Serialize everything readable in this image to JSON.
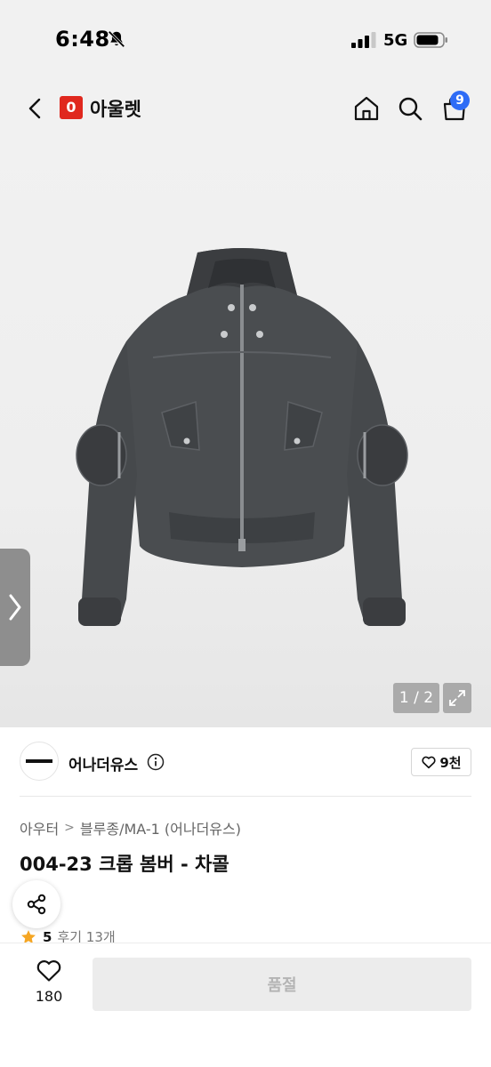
{
  "status_bar": {
    "time": "6:48",
    "network": "5G",
    "icons": [
      "bell-slash-icon",
      "signal-icon",
      "battery-icon"
    ]
  },
  "header": {
    "logo_letter": "0",
    "store_name": "아울렛",
    "cart_count": "9",
    "icons": [
      "back-icon",
      "home-icon",
      "search-icon",
      "cart-icon"
    ],
    "accent_color": "#e0281e",
    "badge_color": "#2e6cf6"
  },
  "gallery": {
    "page_indicator": "1 / 2",
    "product_image": "charcoal cropped bomber jacket with zip pockets on sleeves",
    "icons": [
      "chevron-right-icon",
      "expand-icon"
    ]
  },
  "brand": {
    "name": "어나더유스",
    "like_count": "9천",
    "icons": [
      "info-icon",
      "heart-outline-icon"
    ]
  },
  "breadcrumb": {
    "category": "아우터",
    "subcategory": "블루종/MA-1 (어나더유스)"
  },
  "product": {
    "title": "004-23 크롭 봄버 - 차콜",
    "rating": "5",
    "review_count": "후기 13개",
    "star_color": "#f5a623"
  },
  "bottom_bar": {
    "wish_count": "180",
    "purchase_label": "품절",
    "icons": [
      "heart-outline-icon"
    ]
  }
}
